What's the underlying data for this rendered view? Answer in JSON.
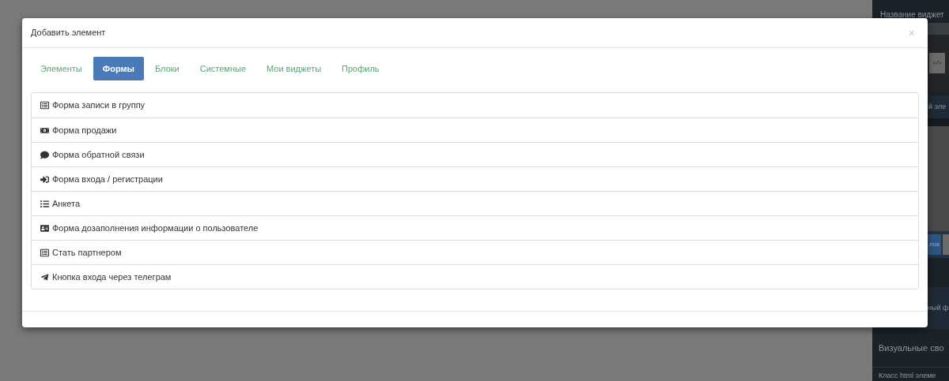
{
  "background_panel": {
    "widget_name_label": "Название виджет",
    "code_button": "</>",
    "section_label": "й эле",
    "block_button": "лок",
    "field_label": "ный ф",
    "visual_heading": "Визуальные сво",
    "class_label": "Класс html элеме"
  },
  "modal": {
    "title": "Добавить элемент",
    "close": "×",
    "tabs": [
      {
        "label": "Элементы",
        "selected": false
      },
      {
        "label": "Формы",
        "selected": true
      },
      {
        "label": "Блоки",
        "selected": false
      },
      {
        "label": "Системные",
        "selected": false
      },
      {
        "label": "Мои виджеты",
        "selected": false
      },
      {
        "label": "Профиль",
        "selected": false
      }
    ],
    "items": [
      {
        "label": "Форма записи в группу"
      },
      {
        "label": "Форма продажи"
      },
      {
        "label": "Форма обратной связи"
      },
      {
        "label": "Форма входа / регистрации"
      },
      {
        "label": "Анкета"
      },
      {
        "label": "Форма дозаполнения информации о пользователе"
      },
      {
        "label": "Стать партнером"
      },
      {
        "label": "Кнопка входа через телеграм"
      }
    ]
  }
}
